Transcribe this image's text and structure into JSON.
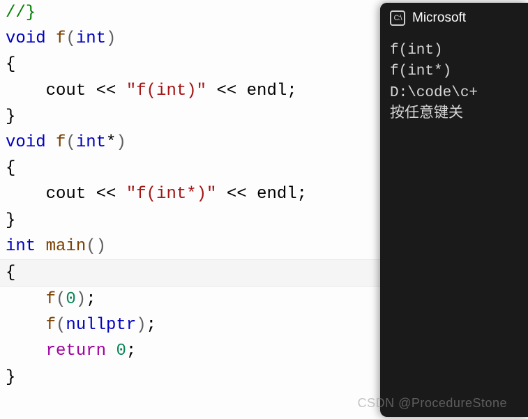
{
  "editor": {
    "lines": {
      "l0": {
        "comment": "//}"
      },
      "l1": {
        "kw": "void",
        "sp": " ",
        "fn": "f",
        "po": "(",
        "kw2": "int",
        "pc": ")"
      },
      "l2": {
        "brace": "{"
      },
      "l3": {
        "pad": "    ",
        "id": "cout",
        "op1": " << ",
        "str": "\"f(int)\"",
        "op2": " << ",
        "id2": "endl",
        "semi": ";"
      },
      "l4": {
        "brace": "}"
      },
      "l5": {
        "kw": "void",
        "sp": " ",
        "fn": "f",
        "po": "(",
        "kw2": "int",
        "star": "*",
        "pc": ")"
      },
      "l6": {
        "brace": "{"
      },
      "l7": {
        "pad": "    ",
        "id": "cout",
        "op1": " << ",
        "str": "\"f(int*)\"",
        "op2": " << ",
        "id2": "endl",
        "semi": ";"
      },
      "l8": {
        "brace": "}"
      },
      "l9": {
        "kw": "int",
        "sp": " ",
        "fn": "main",
        "po": "(",
        "pc": ")"
      },
      "l10": {
        "brace": "{"
      },
      "l11": {
        "pad": "    ",
        "fn": "f",
        "po": "(",
        "num": "0",
        "pc": ")",
        "semi": ";"
      },
      "l12": {
        "pad": "    ",
        "fn": "f",
        "po": "(",
        "kw": "nullptr",
        "pc": ")",
        "semi": ";"
      },
      "l13": {
        "pad": "    ",
        "kw": "return",
        "sp": " ",
        "num": "0",
        "semi": ";"
      },
      "l14": {
        "brace": "}"
      }
    }
  },
  "terminal": {
    "icon_label": "C:\\",
    "title": "Microsoft",
    "out1": "f(int)",
    "out2": "f(int*)",
    "blank": "",
    "path": "D:\\code\\c+",
    "prompt": "按任意键关"
  },
  "watermark": "CSDN @ProcedureStone"
}
